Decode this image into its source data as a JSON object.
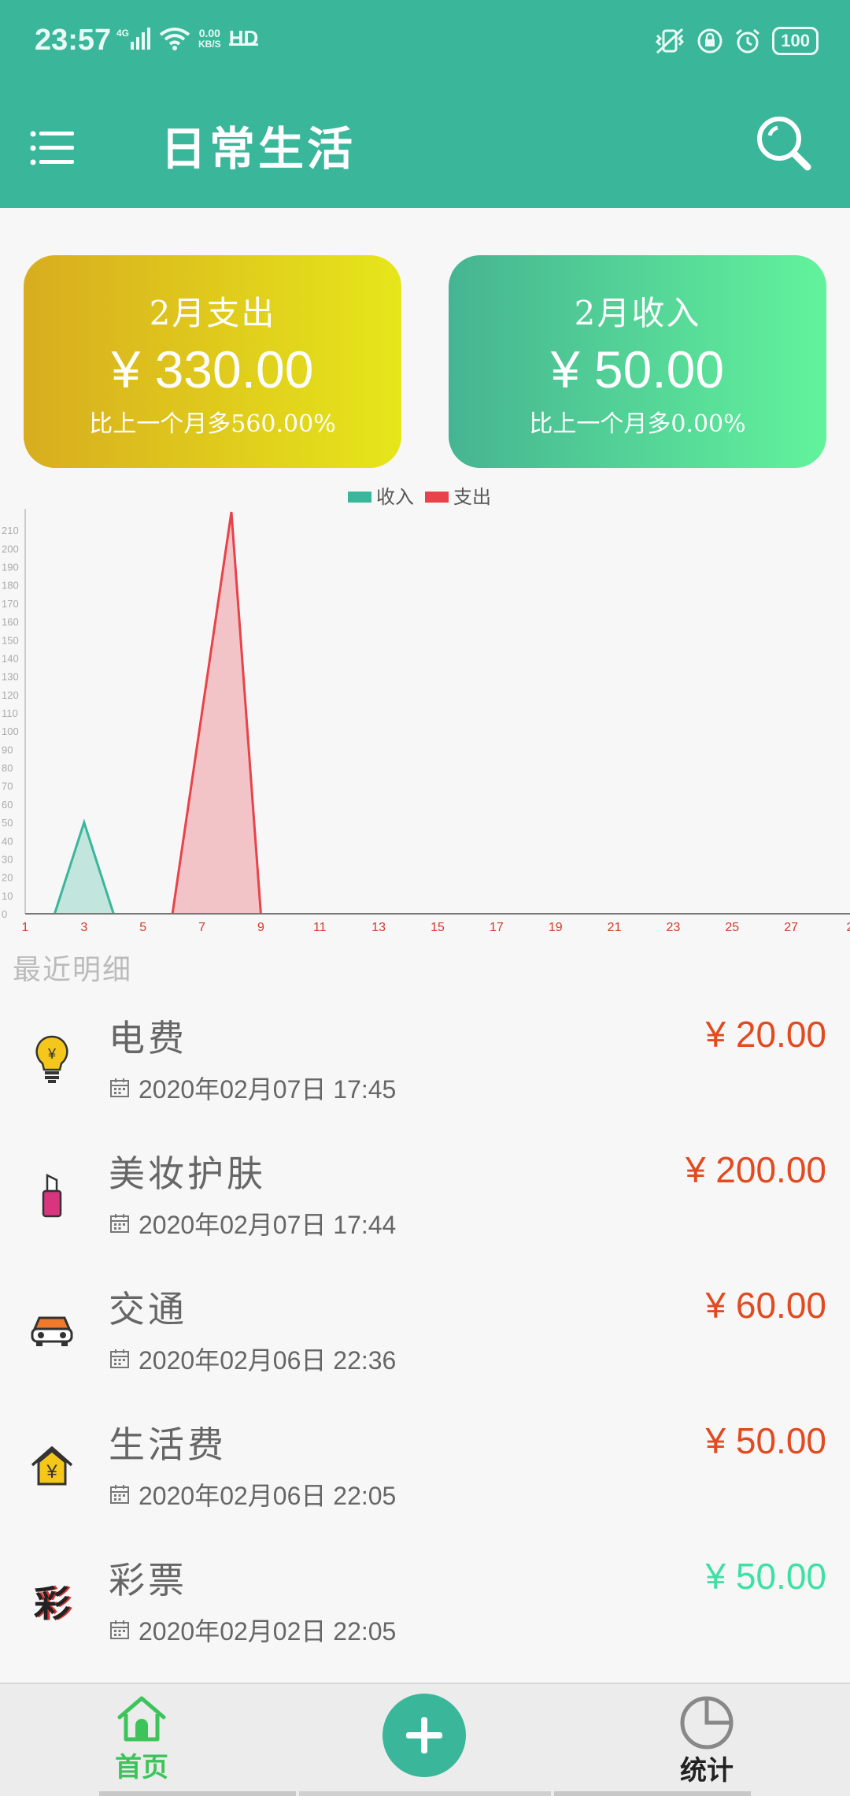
{
  "status_bar": {
    "time": "23:57",
    "network": "4G",
    "speed_value": "0.00",
    "speed_unit": "KB/S",
    "hd": "HD",
    "battery": "100"
  },
  "app_bar": {
    "title": "日常生活",
    "menu_icon": "menu-icon",
    "search_icon": "search-icon"
  },
  "summary": {
    "expense": {
      "title": "2月支出",
      "amount": "¥ 330.00",
      "compare": "比上一个月多560.00%"
    },
    "income": {
      "title": "2月收入",
      "amount": "¥ 50.00",
      "compare": "比上一个月多0.00%"
    }
  },
  "colors": {
    "brand": "#3ab69a",
    "income": "#3ab69a",
    "expense": "#e8424a",
    "amount_expense": "#e24a1f",
    "amount_income": "#3ee0a6"
  },
  "chart_data": {
    "type": "area",
    "legend": [
      "收入",
      "支出"
    ],
    "legend_position": "top-center",
    "x_ticks": [
      "1",
      "3",
      "5",
      "7",
      "9",
      "11",
      "13",
      "15",
      "17",
      "19",
      "21",
      "23",
      "25",
      "27",
      "2"
    ],
    "y_ticks": [
      "0",
      "10",
      "20",
      "30",
      "40",
      "50",
      "60",
      "70",
      "80",
      "90",
      "100",
      "110",
      "120",
      "130",
      "140",
      "150",
      "160",
      "170",
      "180",
      "190",
      "200",
      "210"
    ],
    "ylim": [
      0,
      220
    ],
    "xlim": [
      1,
      29
    ],
    "grid": false,
    "series": [
      {
        "name": "收入",
        "color": "#3ab69a",
        "x": [
          2,
          3,
          4
        ],
        "y": [
          0,
          50,
          0
        ]
      },
      {
        "name": "支出",
        "color": "#e8424a",
        "x": [
          6,
          8,
          9
        ],
        "y": [
          0,
          220,
          0
        ]
      }
    ]
  },
  "recent": {
    "label": "最近明细",
    "items": [
      {
        "name": "电费",
        "date": "2020年02月07日 17:45",
        "amount": "¥ 20.00",
        "type": "expense",
        "icon": "lightbulb-icon"
      },
      {
        "name": "美妆护肤",
        "date": "2020年02月07日 17:44",
        "amount": "¥ 200.00",
        "type": "expense",
        "icon": "lipstick-icon"
      },
      {
        "name": "交通",
        "date": "2020年02月06日 22:36",
        "amount": "¥ 60.00",
        "type": "expense",
        "icon": "car-icon"
      },
      {
        "name": "生活费",
        "date": "2020年02月06日 22:05",
        "amount": "¥ 50.00",
        "type": "expense",
        "icon": "house-yuan-icon"
      },
      {
        "name": "彩票",
        "date": "2020年02月02日 22:05",
        "amount": "¥ 50.00",
        "type": "income",
        "icon": "lottery-icon",
        "icon_text": "彩"
      }
    ]
  },
  "bottom_nav": {
    "home_label": "首页",
    "stats_label": "统计",
    "home_color": "#3cc45a",
    "stats_color": "#222222"
  }
}
